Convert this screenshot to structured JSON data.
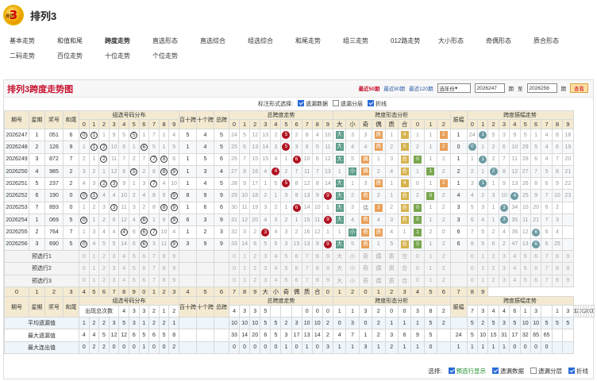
{
  "app": {
    "title": "排列3",
    "logo_text": "3",
    "logo_small": "排列"
  },
  "nav": {
    "row1": [
      "基本走势",
      "和值和尾",
      "跨度走势",
      "直选形态",
      "直选综合",
      "组选综合",
      "和尾走势",
      "组三走势",
      "012路走势",
      "大小形态",
      "奇偶形态",
      "质合形态"
    ],
    "row2": [
      "二码走势",
      "百位走势",
      "十位走势",
      "个位走势"
    ],
    "active": "跨度走势"
  },
  "panel": {
    "title": "排列3跨度走势图",
    "recent": [
      "最近50期",
      "最近80期",
      "最近120期"
    ],
    "select_value": "选年份",
    "from_value": "2026247",
    "period_label": "期",
    "to_label": "至",
    "to_value": "2026256",
    "query_label": "查看"
  },
  "options": {
    "label": "标注形式选择:",
    "items": [
      {
        "label": "遗漏数据",
        "checked": true
      },
      {
        "label": "遗漏分层",
        "checked": false
      },
      {
        "label": "折线",
        "checked": true
      }
    ]
  },
  "headers": {
    "period": "期号",
    "week": "星期",
    "num": "奖号",
    "sum": "和尾",
    "group_dist": "组选号码分布",
    "bai_shi": "百十跨",
    "shi_ge": "十个跨",
    "total_span": "总跨",
    "span_trend": "总跨度走势",
    "form": "跨度形态分析",
    "amp": "振幅",
    "amp_trend": "跨度振幅走势",
    "digits": [
      "0",
      "1",
      "2",
      "3",
      "4",
      "5",
      "6",
      "7",
      "8",
      "9"
    ],
    "form_cols": [
      "大",
      "小",
      "奇",
      "偶",
      "质",
      "合",
      "0",
      "1",
      "2"
    ]
  },
  "rows": [
    {
      "p": "2026247",
      "w": "1",
      "n": "051",
      "s": "6",
      "g": [
        "0",
        "1",
        "1",
        "9",
        "5",
        "5",
        "1",
        "7",
        "1",
        "4"
      ],
      "gb": [
        0,
        1,
        5
      ],
      "bs": "5",
      "sg": "4",
      "ts": "5",
      "st": [
        "24",
        "5",
        "12",
        "13",
        "2",
        "5",
        "2",
        "8",
        "4",
        "10"
      ],
      "sp": 5,
      "fm": [
        "大",
        "3",
        "3",
        "质",
        "1",
        "4",
        "1",
        "1",
        "2"
      ],
      "fh": [
        0,
        3,
        5,
        8
      ],
      "am": "1",
      "at": [
        "24",
        "1",
        "5",
        "3",
        "9",
        "5",
        "1",
        "4",
        "8",
        "18"
      ],
      "ap": 1
    },
    {
      "p": "2026248",
      "w": "2",
      "n": "126",
      "s": "9",
      "g": [
        "1",
        "1",
        "2",
        "10",
        "6",
        "1",
        "6",
        "5",
        "1",
        "5"
      ],
      "gb": [
        1,
        2,
        6
      ],
      "bs": "1",
      "sg": "4",
      "ts": "5",
      "st": [
        "25",
        "6",
        "13",
        "14",
        "3",
        "5",
        "3",
        "9",
        "5",
        "11"
      ],
      "sp": 5,
      "fm": [
        "大",
        "4",
        "4",
        "质",
        "2",
        "5",
        "2",
        "1",
        "2"
      ],
      "fh": [
        0,
        3,
        5,
        8
      ],
      "am": "0",
      "at": [
        "0",
        "1",
        "2",
        "6",
        "10",
        "29",
        "5",
        "4",
        "6",
        "19"
      ],
      "ap": 0
    },
    {
      "p": "2026249",
      "w": "3",
      "n": "872",
      "s": "7",
      "g": [
        "2",
        "1",
        "2",
        "11",
        "7",
        "2",
        "7",
        "8",
        "2",
        "6"
      ],
      "gb": [
        2,
        7,
        8
      ],
      "bs": "1",
      "sg": "5",
      "ts": "6",
      "st": [
        "26",
        "7",
        "15",
        "15",
        "4",
        "1",
        "6",
        "10",
        "6",
        "12"
      ],
      "sp": 6,
      "fm": [
        "大",
        "5",
        "偶",
        "1",
        "3",
        "合",
        "0",
        "1",
        "2"
      ],
      "fh": [
        0,
        2,
        5,
        6
      ],
      "am": "1",
      "at": [
        "1",
        "1",
        "2",
        "7",
        "11",
        "28",
        "6",
        "4",
        "7",
        "20"
      ],
      "ap": 1
    },
    {
      "p": "2026250",
      "w": "4",
      "n": "985",
      "s": "2",
      "g": [
        "3",
        "2",
        "1",
        "12",
        "8",
        "5",
        "2",
        "8",
        "8",
        "9"
      ],
      "gb": [
        5,
        8,
        9
      ],
      "bs": "1",
      "sg": "3",
      "ts": "4",
      "st": [
        "27",
        "8",
        "16",
        "4",
        "5",
        "2",
        "7",
        "11",
        "7",
        "13"
      ],
      "sp": 4,
      "fm": [
        "1",
        "小",
        "偶",
        "2",
        "4",
        "合",
        "1",
        "1",
        "2"
      ],
      "fh": [
        1,
        2,
        5,
        7
      ],
      "am": "2",
      "at": [
        "2",
        "1",
        "2",
        "8",
        "12",
        "27",
        "7",
        "5",
        "8",
        "21"
      ],
      "ap": 2
    },
    {
      "p": "2026251",
      "w": "5",
      "n": "237",
      "s": "2",
      "g": [
        "4",
        "3",
        "2",
        "3",
        "9",
        "1",
        "3",
        "7",
        "4",
        "10"
      ],
      "gb": [
        2,
        3,
        7
      ],
      "bs": "1",
      "sg": "4",
      "ts": "5",
      "st": [
        "28",
        "9",
        "17",
        "1",
        "5",
        "3",
        "8",
        "12",
        "8",
        "14"
      ],
      "sp": 5,
      "fm": [
        "大",
        "1",
        "3",
        "质",
        "1",
        "4",
        "0",
        "1",
        "2"
      ],
      "fh": [
        0,
        3,
        5,
        8
      ],
      "am": "1",
      "at": [
        "3",
        "1",
        "1",
        "9",
        "13",
        "26",
        "8",
        "6",
        "9",
        "22"
      ],
      "ap": 1
    },
    {
      "p": "2026252",
      "w": "6",
      "n": "190",
      "s": "0",
      "g": [
        "0",
        "1",
        "4",
        "4",
        "10",
        "2",
        "4",
        "8",
        "9",
        "9"
      ],
      "gb": [
        0,
        1,
        9
      ],
      "bs": "8",
      "sg": "9",
      "ts": "9",
      "st": [
        "29",
        "10",
        "18",
        "2",
        "1",
        "3",
        "9",
        "13",
        "9",
        "9"
      ],
      "sp": 9,
      "fm": [
        "大",
        "2",
        "奇",
        "2",
        "1",
        "合",
        "2",
        "0",
        "2"
      ],
      "fh": [
        0,
        2,
        5,
        7
      ],
      "am": "4",
      "at": [
        "4",
        "2",
        "3",
        "10",
        "4",
        "25",
        "9",
        "7",
        "10",
        "23"
      ],
      "ap": 4
    },
    {
      "p": "2026253",
      "w": "7",
      "n": "893",
      "s": "0",
      "g": [
        "1",
        "2",
        "3",
        "3",
        "11",
        "3",
        "2",
        "8",
        "9",
        "9"
      ],
      "gb": [
        3,
        8,
        9
      ],
      "bs": "1",
      "sg": "6",
      "ts": "6",
      "st": [
        "30",
        "11",
        "19",
        "3",
        "2",
        "1",
        "6",
        "14",
        "10",
        "1"
      ],
      "sp": 6,
      "fm": [
        "大",
        "3",
        "偶",
        "3",
        "2",
        "合",
        "0",
        "1",
        "2"
      ],
      "fh": [
        0,
        3,
        5,
        6
      ],
      "am": "3",
      "at": [
        "5",
        "3",
        "1",
        "3",
        "34",
        "10",
        "20",
        "6",
        "2"
      ],
      "ap": 3
    },
    {
      "p": "2026254",
      "w": "1",
      "n": "069",
      "s": "5",
      "g": [
        "0",
        "1",
        "2",
        "6",
        "12",
        "4",
        "6",
        "1",
        "9",
        "9"
      ],
      "gb": [
        0,
        6,
        9
      ],
      "bs": "6",
      "sg": "3",
      "ts": "9",
      "st": [
        "31",
        "12",
        "20",
        "4",
        "3",
        "2",
        "1",
        "15",
        "11",
        "9"
      ],
      "sp": 9,
      "fm": [
        "大",
        "4",
        "奇",
        "4",
        "3",
        "合",
        "0",
        "1",
        "2"
      ],
      "fh": [
        0,
        2,
        5,
        6
      ],
      "am": "3",
      "at": [
        "6",
        "4",
        "1",
        "3",
        "35",
        "11",
        "21",
        "7",
        "3"
      ],
      "ap": 3
    },
    {
      "p": "2026255",
      "w": "2",
      "n": "764",
      "s": "7",
      "g": [
        "1",
        "3",
        "4",
        "4",
        "13",
        "6",
        "7",
        "2",
        "10",
        "4"
      ],
      "gb": [
        4,
        6,
        7
      ],
      "bs": "1",
      "sg": "2",
      "ts": "3",
      "st": [
        "32",
        "3",
        "2",
        "5",
        "4",
        "3",
        "2",
        "16",
        "12",
        "1"
      ],
      "sp": 3,
      "fm": [
        "1",
        "小",
        "奇",
        "质",
        "4",
        "1",
        "1",
        "2",
        "0"
      ],
      "fh": [
        1,
        2,
        3,
        6
      ],
      "am": "6",
      "at": [
        "7",
        "5",
        "2",
        "4",
        "36",
        "12",
        "22",
        "6",
        "4"
      ],
      "ap": 6
    },
    {
      "p": "2026256",
      "w": "3",
      "n": "690",
      "s": "5",
      "g": [
        "0",
        "4",
        "5",
        "5",
        "14",
        "6",
        "7",
        "3",
        "11",
        "9"
      ],
      "gb": [
        0,
        6,
        9
      ],
      "bs": "3",
      "sg": "9",
      "ts": "9",
      "st": [
        "33",
        "14",
        "6",
        "5",
        "5",
        "3",
        "15",
        "13",
        "9",
        "1"
      ],
      "sp": 9,
      "fm": [
        "大",
        "5",
        "奇",
        "1",
        "5",
        "合",
        "0",
        "1",
        "2"
      ],
      "fh": [
        0,
        2,
        5,
        6
      ],
      "am": "6",
      "at": [
        "8",
        "5",
        "6",
        "2",
        "47",
        "13",
        "5",
        "6",
        "25"
      ],
      "ap": 6
    }
  ],
  "pre_rows": [
    "预选行1",
    "预选行2",
    "预选行3"
  ],
  "stats": [
    {
      "label": "出现总次数",
      "vals": [
        "4",
        "3",
        "3",
        "2",
        "1",
        "2",
        "4",
        "3",
        "3",
        "5",
        "",
        "",
        "",
        "0",
        "0",
        "0",
        "1",
        "1",
        "3",
        "2",
        "0",
        "0",
        "3",
        "8",
        "2",
        "7",
        "3",
        "4",
        "4",
        "6",
        "1",
        "3",
        "",
        "1",
        "3",
        "1",
        "2",
        "1",
        "0",
        "2",
        "0",
        "0",
        "0"
      ]
    },
    {
      "label": "平均遗漏值",
      "vals": [
        "1",
        "2",
        "2",
        "3",
        "5",
        "3",
        "1",
        "2",
        "2",
        "1",
        "",
        "",
        "",
        "10",
        "10",
        "10",
        "5",
        "5",
        "2",
        "3",
        "10",
        "10",
        "2",
        "0",
        "3",
        "0",
        "2",
        "1",
        "1",
        "1",
        "5",
        "2",
        "",
        "5",
        "2",
        "5",
        "3",
        "5",
        "10",
        "10",
        "5",
        "5",
        "5"
      ]
    },
    {
      "label": "最大遗漏值",
      "vals": [
        "4",
        "4",
        "5",
        "12",
        "12",
        "6",
        "5",
        "6",
        "5",
        "8",
        "",
        "",
        "",
        "33",
        "14",
        "20",
        "6",
        "5",
        "3",
        "17",
        "13",
        "14",
        "2",
        "4",
        "7",
        "1",
        "2",
        "3",
        "6",
        "9",
        "5",
        "",
        "24",
        "5",
        "10",
        "15",
        "31",
        "17",
        "32",
        "65",
        "65"
      ]
    },
    {
      "label": "最大连出值",
      "vals": [
        "0",
        "2",
        "2",
        "0",
        "0",
        "0",
        "1",
        "0",
        "0",
        "2",
        "",
        "",
        "",
        "0",
        "0",
        "0",
        "0",
        "0",
        "1",
        "0",
        "1",
        "0",
        "3",
        "1",
        "1",
        "3",
        "1",
        "2",
        "1",
        "1",
        "0",
        "",
        "1",
        "1",
        "1",
        "1",
        "1",
        "0",
        "0",
        "0",
        "0"
      ]
    }
  ],
  "bottom": {
    "label": "选择:",
    "items": [
      {
        "label": "预选行显示",
        "checked": true,
        "accent": true
      },
      {
        "label": "遗漏数据",
        "checked": true
      },
      {
        "label": "遗漏分层",
        "checked": false
      },
      {
        "label": "折线",
        "checked": true
      }
    ]
  },
  "colors": {
    "accent": "#c8102e",
    "header_bg": "#f3ead1",
    "ball_red": "#b01020",
    "ball_teal": "#6c9aa3"
  }
}
